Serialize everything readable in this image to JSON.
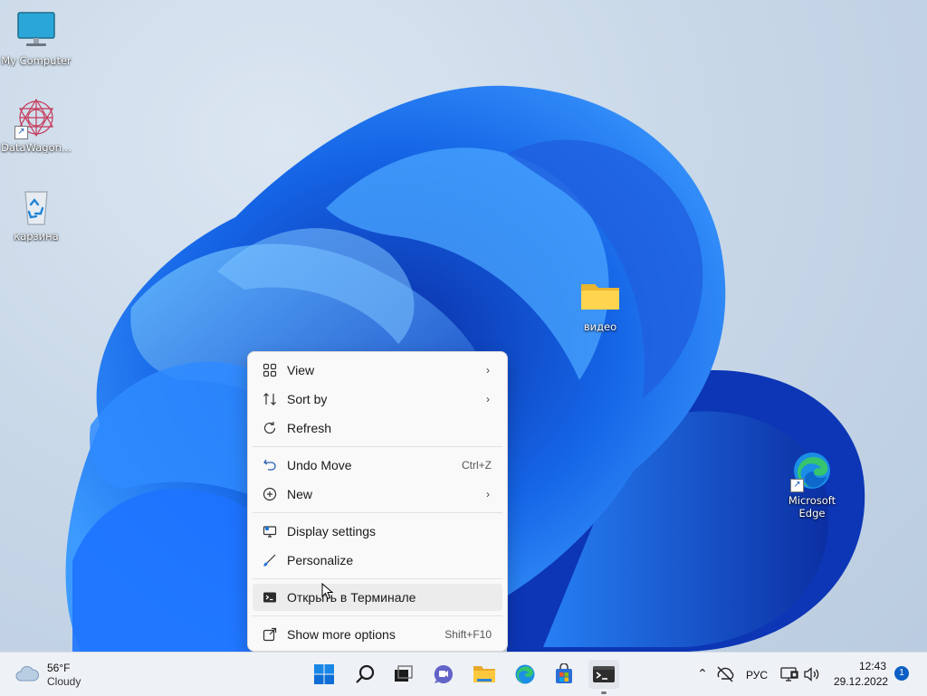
{
  "desktop": {
    "icons": [
      {
        "label": "My Computer"
      },
      {
        "label": "DataWagon..."
      },
      {
        "label": "карзина"
      },
      {
        "label": "видео"
      },
      {
        "label": "Microsoft Edge"
      }
    ]
  },
  "context_menu": {
    "items": [
      {
        "label": "View",
        "shortcut": "",
        "icon": "grid-icon",
        "submenu": true
      },
      {
        "label": "Sort by",
        "shortcut": "",
        "icon": "sort-icon",
        "submenu": true
      },
      {
        "label": "Refresh",
        "shortcut": "",
        "icon": "refresh-icon",
        "submenu": false
      },
      {
        "label": "Undo Move",
        "shortcut": "Ctrl+Z",
        "icon": "undo-icon",
        "submenu": false
      },
      {
        "label": "New",
        "shortcut": "",
        "icon": "plus-circle-icon",
        "submenu": true
      },
      {
        "label": "Display settings",
        "shortcut": "",
        "icon": "display-icon",
        "submenu": false
      },
      {
        "label": "Personalize",
        "shortcut": "",
        "icon": "brush-icon",
        "submenu": false
      },
      {
        "label": "Открыть в Терминале",
        "shortcut": "",
        "icon": "terminal-icon",
        "submenu": false
      },
      {
        "label": "Show more options",
        "shortcut": "Shift+F10",
        "icon": "share-icon",
        "submenu": false
      }
    ]
  },
  "taskbar": {
    "weather": {
      "temp": "56°F",
      "condition": "Cloudy"
    },
    "pinned": [
      "start-icon",
      "search-icon",
      "task-view-icon",
      "chat-icon",
      "file-explorer-icon",
      "edge-icon",
      "store-icon",
      "terminal-icon"
    ],
    "tray": {
      "language": "РУС",
      "time": "12:43",
      "date": "29.12.2022",
      "notifications": "1"
    }
  },
  "colors": {
    "accent": "#0c5fc4",
    "menu_bg": "#f9f9f9",
    "taskbar_bg": "#eef1f5"
  }
}
